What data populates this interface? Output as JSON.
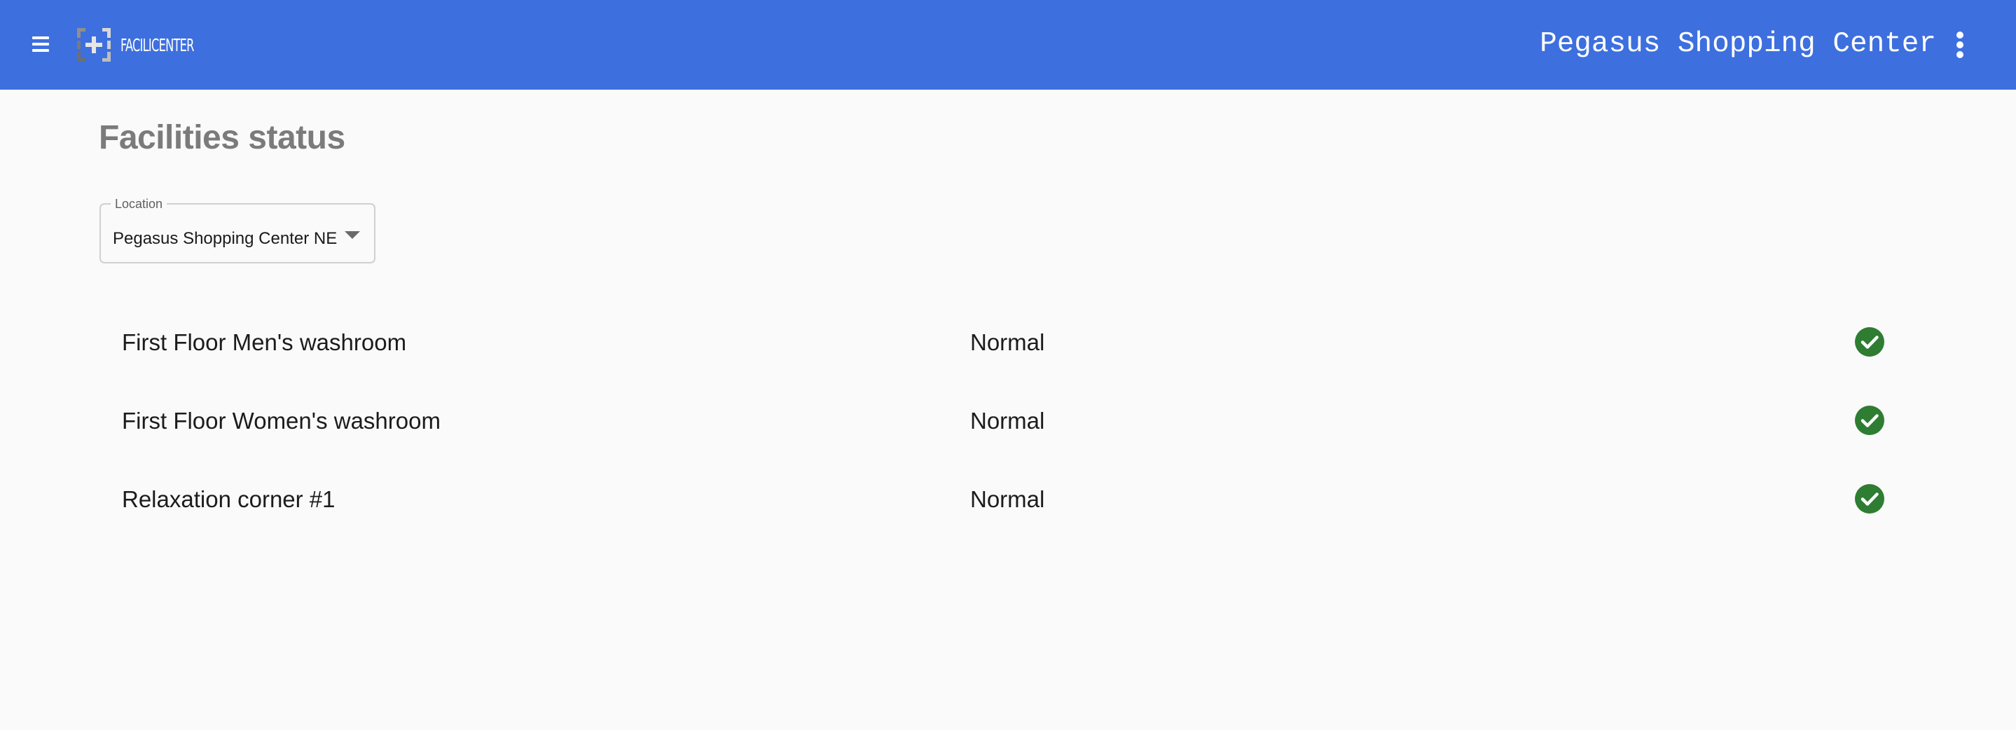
{
  "header": {
    "logo_text": "FACILICENTER",
    "site_title": "Pegasus Shopping Center",
    "icons": {
      "menu": "hamburger-menu-icon",
      "more": "more-vertical-icon",
      "logo": "facilicenter-logo"
    },
    "accent_color": "#3d6fde"
  },
  "page": {
    "title": "Facilities status"
  },
  "location_select": {
    "label": "Location",
    "value": "Pegasus Shopping Center NE"
  },
  "facilities": [
    {
      "name": "First Floor Men's washroom",
      "status": "Normal",
      "status_icon": "check-circle-icon",
      "status_color": "#2e7d32"
    },
    {
      "name": "First Floor Women's washroom",
      "status": "Normal",
      "status_icon": "check-circle-icon",
      "status_color": "#2e7d32"
    },
    {
      "name": "Relaxation corner #1",
      "status": "Normal",
      "status_icon": "check-circle-icon",
      "status_color": "#2e7d32"
    }
  ]
}
